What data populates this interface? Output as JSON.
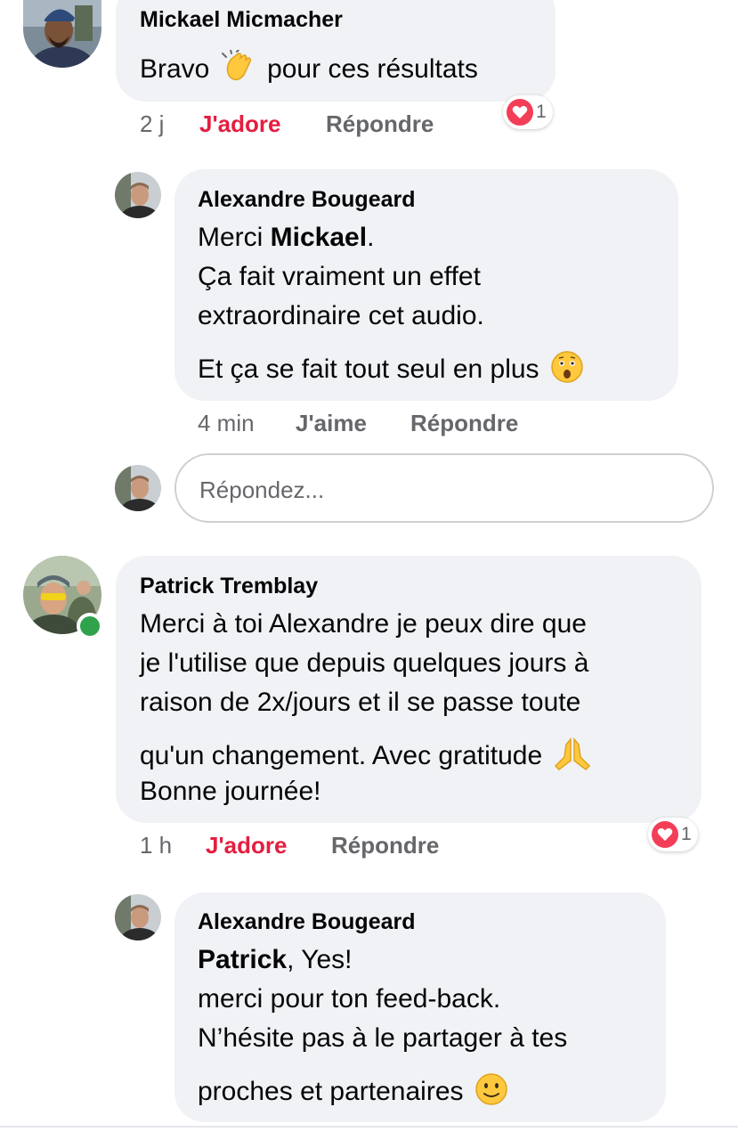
{
  "comments": [
    {
      "author": "Mickael Micmacher",
      "text_before": "Bravo",
      "emoji": "clapping-hands",
      "text_after": "pour ces résultats",
      "time": "2 j",
      "reaction": "J'adore",
      "reply": "Répondre",
      "reaction_icon": "heart-icon",
      "reaction_count": "1"
    },
    {
      "author": "Alexandre Bougeard",
      "line1_prefix": "Merci ",
      "line1_bold": "Mickael",
      "line1_suffix": ".",
      "line2": "Ça fait vraiment un effet",
      "line3": "extraordinaire cet audio.",
      "line4": "Et ça se fait tout seul en plus",
      "emoji": "astonished-face",
      "time": "4 min",
      "like": "J'aime",
      "reply": "Répondre"
    },
    {
      "author": "Patrick Tremblay",
      "line1": "Merci à toi Alexandre je peux dire que",
      "line2": "je l'utilise que depuis quelques jours à",
      "line3": "raison de 2x/jours et il se passe toute",
      "line4": "qu'un changement. Avec gratitude",
      "line4_emoji": "folded-hands",
      "line5": "Bonne journée!",
      "time": "1 h",
      "reaction": "J'adore",
      "reply": "Répondre",
      "reaction_icon": "heart-icon",
      "reaction_count": "1",
      "online": true
    },
    {
      "author": "Alexandre Bougeard",
      "line1_bold": "Patrick",
      "line1_suffix": ", Yes!",
      "line2": "merci pour ton feed-back.",
      "line3": "N’hésite pas à le partager à tes",
      "line4": "proches et partenaires",
      "line4_emoji": "slightly-smiling-face"
    }
  ],
  "reply_box": {
    "placeholder": "Répondez..."
  },
  "colors": {
    "bubble": "#f0f2f5",
    "meta_text": "#65676b",
    "adore": "#e41e3f",
    "heart": "#f33e58",
    "online": "#31a24c"
  }
}
